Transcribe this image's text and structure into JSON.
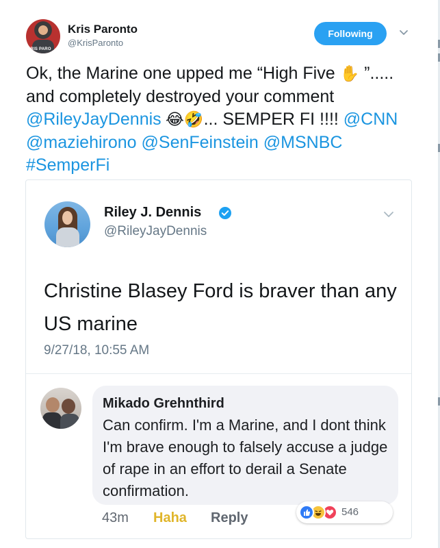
{
  "tweet": {
    "author_name": "Kris Paronto",
    "author_handle": "@KrisParonto",
    "avatar_text": "KRIS PARO",
    "follow_label": "Following",
    "text_1": "Ok, the Marine one upped me “High Five ",
    "emoji_hand": "✋",
    "text_2": " ”..... and completely destroyed your comment ",
    "mention_riley": "@RileyJayDennis",
    "emoji_laugh": " 😂🤣",
    "text_3": "... SEMPER FI !!!! ",
    "mention_cnn": "@CNN",
    "mention_mazie": "@maziehirono",
    "mention_feinstein": "@SenFeinstein",
    "mention_msnbc": "@MSNBC",
    "hashtag": "#SemperFi"
  },
  "quoted": {
    "name": "Riley J. Dennis",
    "handle": "@RileyJayDennis",
    "text": "Christine Blasey Ford is braver than any US marine",
    "date": "9/27/18, 10:55 AM"
  },
  "comment": {
    "name": "Mikado Grehnthird",
    "text": "Can confirm. I'm a Marine, and I dont think I'm brave enough to falsely accuse a judge of rape in an effort to derail a Senate confirmation.",
    "time": "43m",
    "haha_label": "Haha",
    "reply_label": "Reply",
    "reaction_count": "546"
  },
  "icons": [
    "caret-down-icon",
    "verified-icon",
    "like-reaction-icon",
    "haha-reaction-icon",
    "love-reaction-icon"
  ],
  "colors": {
    "link": "#1b95e0",
    "follow_button": "#2aa1f2",
    "haha": "#e0b52a"
  }
}
